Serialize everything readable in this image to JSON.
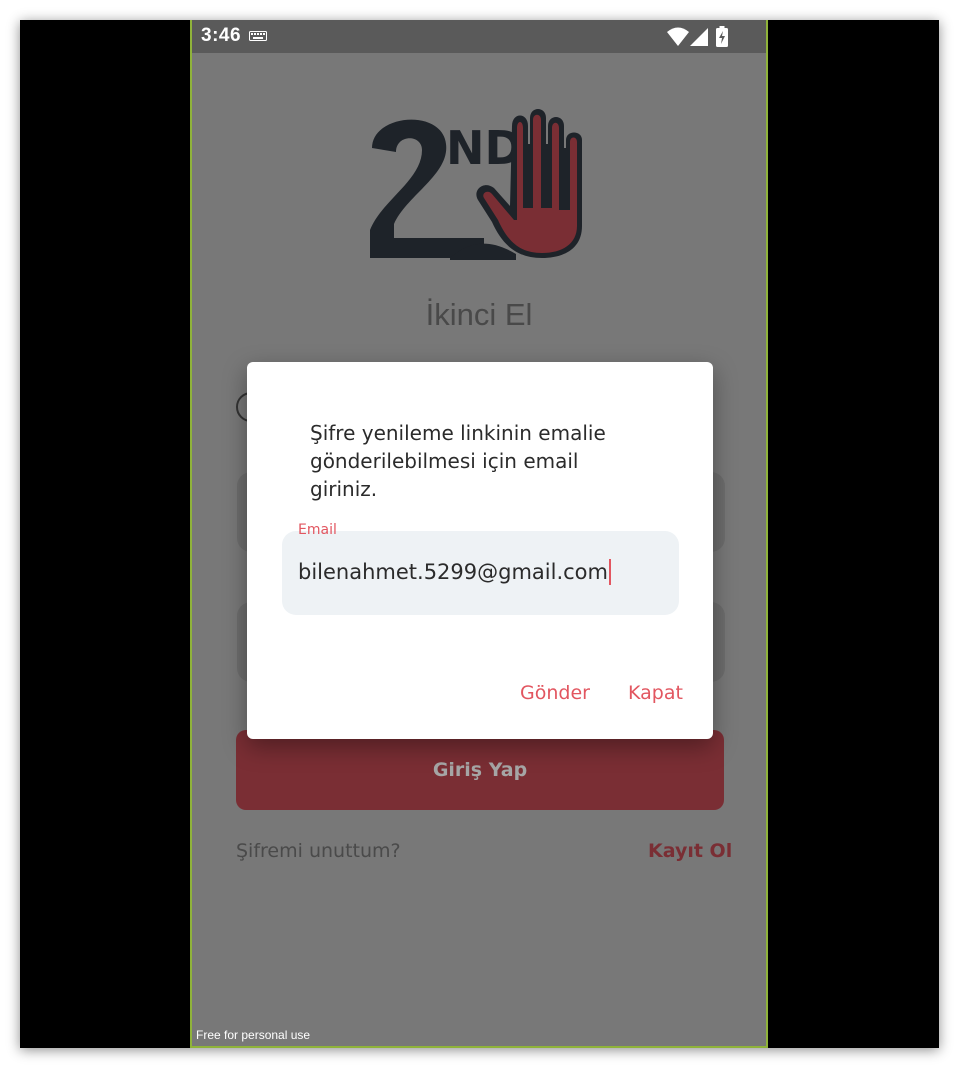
{
  "status_bar": {
    "time": "3:46",
    "icons": [
      "keyboard-icon",
      "wifi-icon",
      "cell-signal-icon",
      "battery-charging-icon"
    ]
  },
  "app": {
    "logo": "2nd-hand-logo",
    "title": "İkinci El",
    "login_button": "Giriş Yap",
    "forgot_password": "Şifremi unuttum?",
    "register": "Kayıt Ol"
  },
  "dialog": {
    "message": "Şifre yenileme linkinin emalie gönderilebilmesi için email giriniz.",
    "email_label": "Email",
    "email_value": "bilenahmet.5299@gmail.com",
    "send_label": "Gönder",
    "close_label": "Kapat"
  },
  "watermark": "Free for personal use",
  "colors": {
    "accent": "#e25660",
    "brand_red": "#7a2e34",
    "scrim": "#787878",
    "status_bar": "#5a5a5a"
  }
}
